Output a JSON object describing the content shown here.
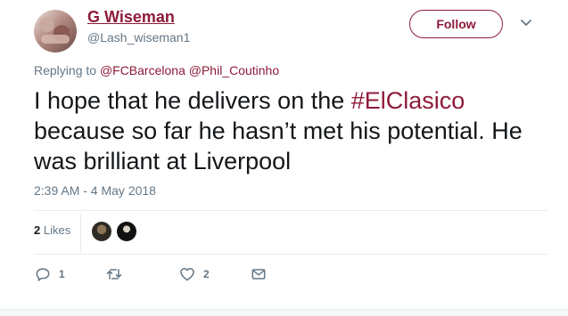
{
  "user": {
    "display_name": "G Wiseman",
    "screen_name": "@Lash_wiseman1"
  },
  "follow_label": "Follow",
  "reply": {
    "prefix": "Replying to",
    "mentions": [
      "@FCBarcelona",
      "@Phil_Coutinho"
    ]
  },
  "tweet": {
    "text_before": "I hope that he delivers on the ",
    "hashtag": "#ElClasico",
    "text_after": " because so far he hasn’t met his potential. He was brilliant at Liverpool"
  },
  "timestamp": "2:39 AM - 4 May 2018",
  "likes": {
    "count": "2",
    "label": "Likes"
  },
  "actions": {
    "reply_count": "1",
    "like_count": "2"
  },
  "icons": [
    "reply-icon",
    "retweet-icon",
    "heart-icon",
    "envelope-icon",
    "chevron-down-icon"
  ],
  "colors": {
    "accent": "#8e1b3a",
    "secondary_text": "#657786",
    "divider": "#e6ecf0"
  }
}
